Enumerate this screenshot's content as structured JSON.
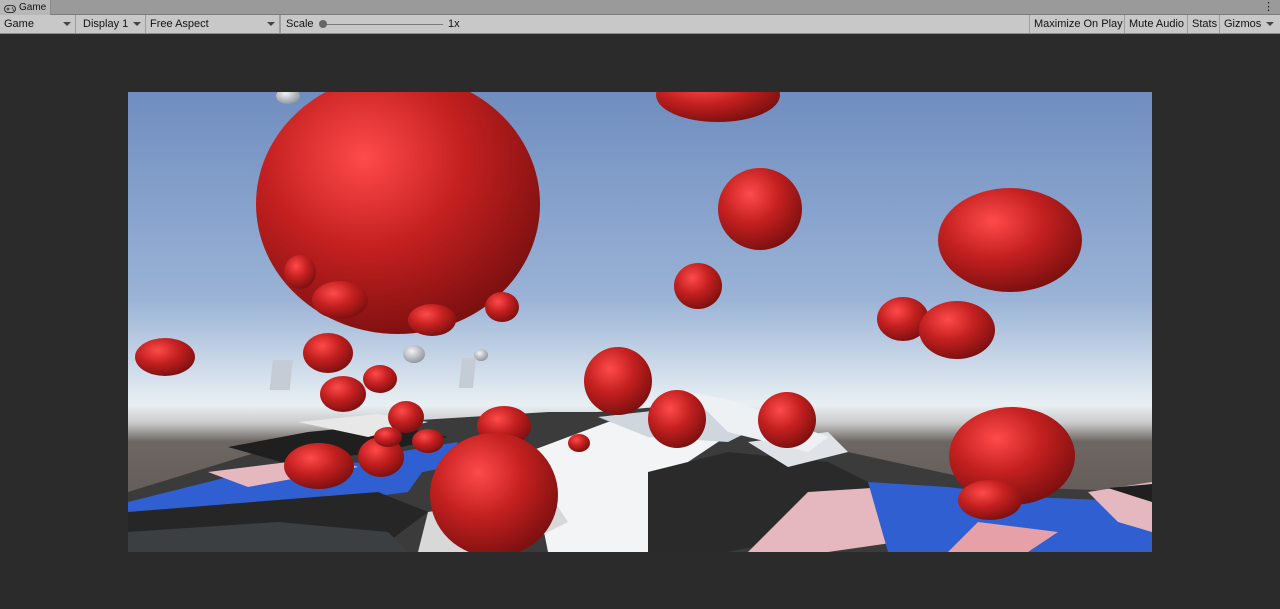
{
  "window": {
    "tab_label": "Game",
    "tab_icon": "gamepad-icon",
    "menu_icon": "kebab-menu-icon"
  },
  "toolbar": {
    "view_mode": "Game",
    "display": "Display 1",
    "aspect": "Free Aspect",
    "scale_label": "Scale",
    "scale_value": "1x",
    "scale_level": 0.0,
    "maximize_on_play": "Maximize On Play",
    "mute_audio": "Mute Audio",
    "stats": "Stats",
    "gizmos": "Gizmos"
  },
  "colors": {
    "editor_background": "#2b2b2b",
    "toolbar_background": "#c8c8c8",
    "sphere_red": "#c42020",
    "cube_blue": "#2f5fd0",
    "cube_dark": "#2e2e2e",
    "cube_white": "#e8e8e8",
    "cube_pink": "#e5b8c0"
  }
}
